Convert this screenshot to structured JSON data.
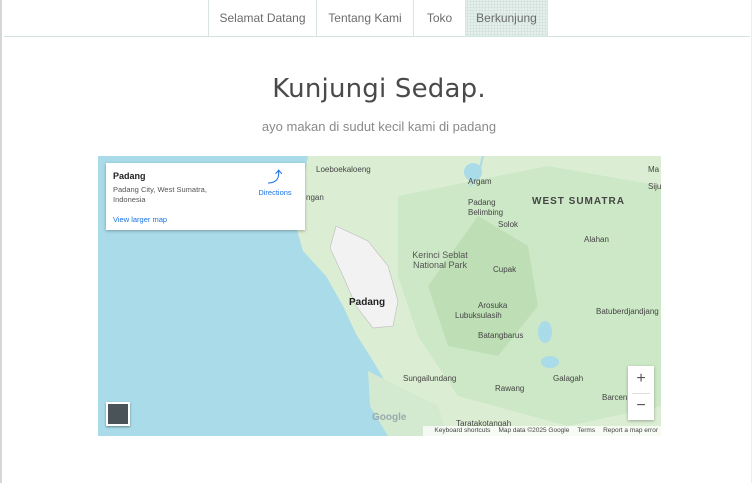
{
  "nav": {
    "items": [
      "Selamat Datang",
      "Tentang Kami",
      "Toko",
      "Berkunjung"
    ],
    "active_index": 3
  },
  "header": {
    "title": "Kunjungi Sedap.",
    "subtitle": "ayo makan di sudut kecil kami di padang"
  },
  "map": {
    "info_card": {
      "name": "Padang",
      "address": "Padang City, West Sumatra, Indonesia",
      "directions": "Directions",
      "larger_map": "View larger map"
    },
    "labels": {
      "loeboekaloeng": "Loeboekaloeng",
      "ngan": "ngan",
      "argam": "Argam",
      "padang_belimbing": "Padang Belimbing",
      "west_sumatra": "WEST SUMATRA",
      "ma": "Ma",
      "siju": "Siju",
      "solok": "Solok",
      "alahan": "Alahan",
      "kerinci": "Kerinci Seblat National Park",
      "cupak": "Cupak",
      "padang": "Padang",
      "arosuka": "Arosuka",
      "lubuksulasih": "Lubuksulasih",
      "batuberdjandjang": "Batuberdjandjang",
      "batangbarus": "Batangbarus",
      "sungailundang": "Sungailundang",
      "galagah": "Galagah",
      "rawang": "Rawang",
      "barcen": "Barcen",
      "tarataktangah": "Taratakotangah"
    },
    "logo": "Google",
    "zoom_in": "+",
    "zoom_out": "−",
    "footer": {
      "shortcuts": "Keyboard shortcuts",
      "data": "Map data ©2025 Google",
      "terms": "Terms",
      "report": "Report a map error"
    },
    "colors": {
      "water": "#a9dbe9",
      "land": "#dbeed3",
      "forest": "#c5e3bd",
      "city": "#f2f2f2"
    }
  }
}
